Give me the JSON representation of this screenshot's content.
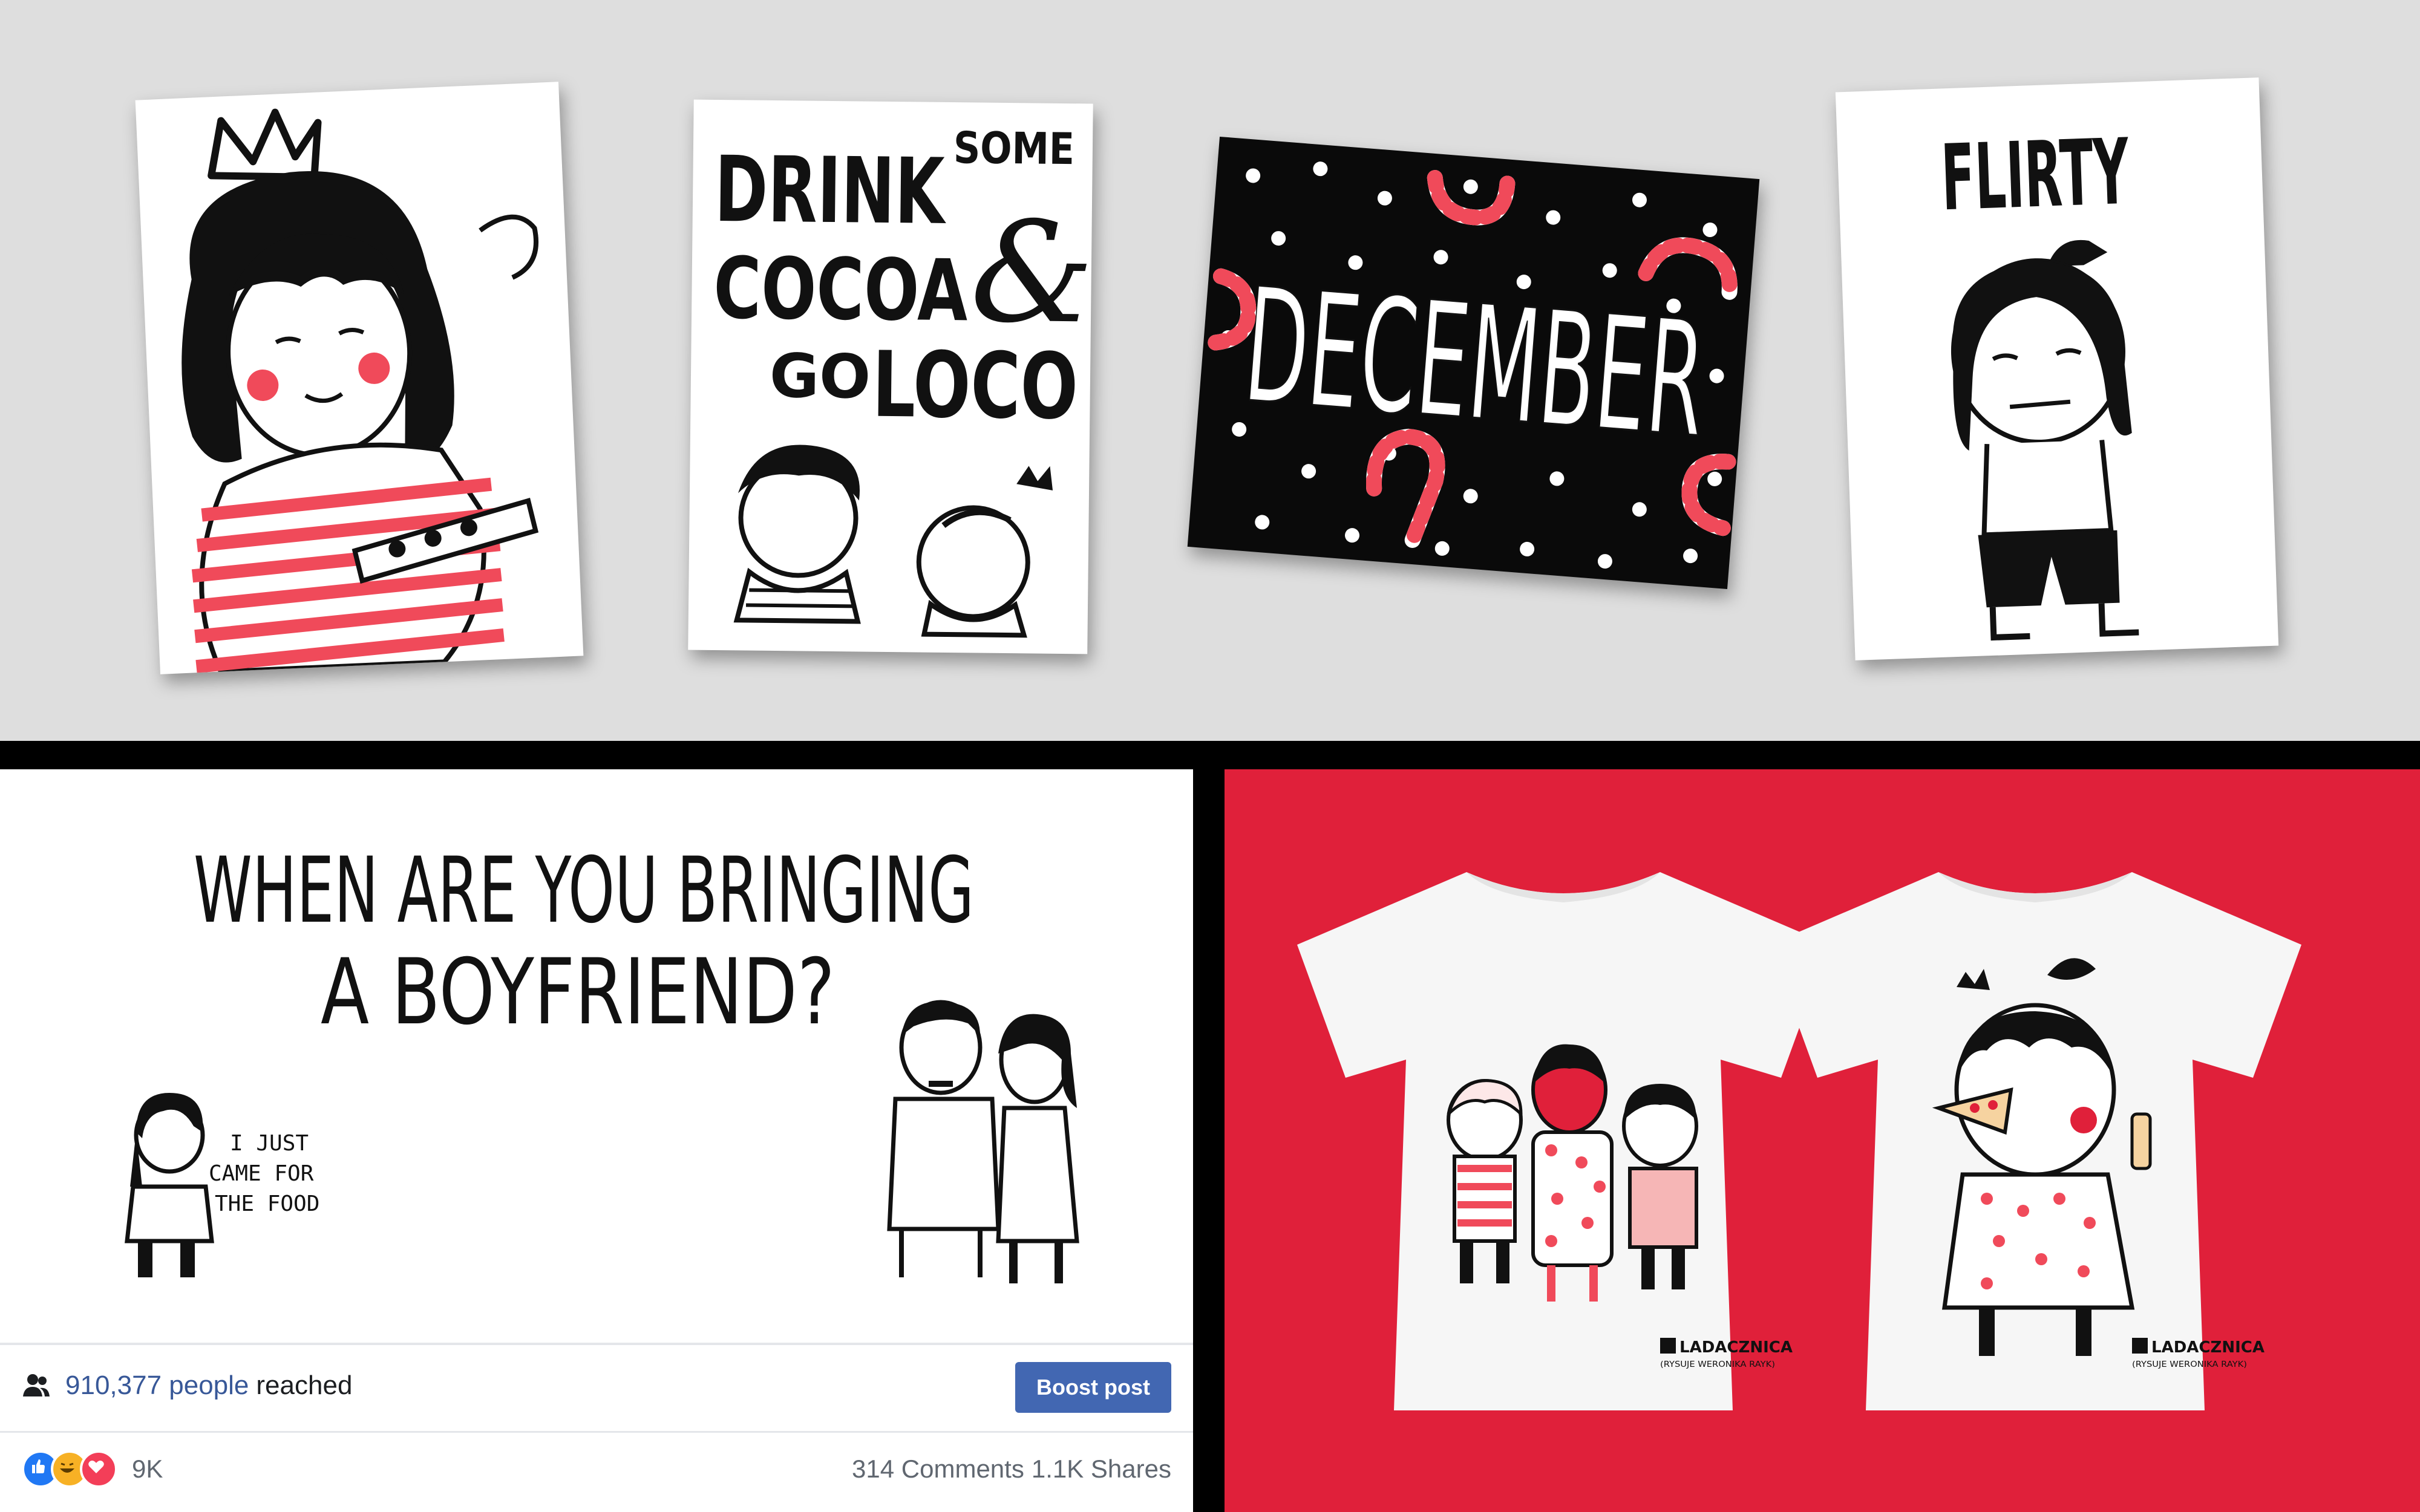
{
  "cards": {
    "princess": {
      "icon": "girl-with-crown-illustration"
    },
    "cocoa": {
      "line1": "DRINK",
      "line1_small": "SOME",
      "line2": "COCOA",
      "line2_amp": "&",
      "line3": "GO",
      "line3b": "LOCO"
    },
    "december": {
      "word": "DECEMBER"
    },
    "flirty": {
      "word": "FLIRTY"
    }
  },
  "facebook_post": {
    "headline_line1": "WHEN ARE YOU BRINGING",
    "headline_line2": "A BOYFRIEND?",
    "speech_line1": "I JUST",
    "speech_line2": "CAME FOR",
    "speech_line3": "THE FOOD",
    "reach_count": "910,377 people",
    "reach_label": "reached",
    "boost_label": "Boost post",
    "reaction_count": "9K",
    "comments": "314 Comments",
    "shares": "1.1K Shares"
  },
  "tshirts": {
    "brand": "LADACZNICA",
    "tagline": "(RYSUJE WERONIKA RAYK)"
  },
  "colors": {
    "accent_red": "#e0203a",
    "pink": "#f04a5a",
    "facebook_blue": "#4267b2",
    "link_blue": "#385898"
  }
}
